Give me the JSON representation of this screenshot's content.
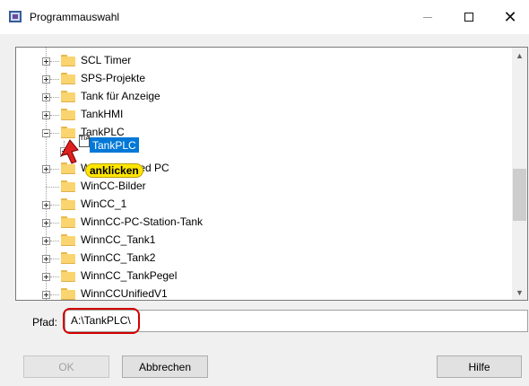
{
  "window": {
    "title": "Programmauswahl",
    "controls": {
      "minimize": "—",
      "maximize": "☐",
      "close": "✕"
    }
  },
  "tree": {
    "items": [
      {
        "label": "SCL Timer",
        "expandable": true,
        "expanded": false
      },
      {
        "label": "SPS-Projekte",
        "expandable": true,
        "expanded": false
      },
      {
        "label": "Tank für Anzeige",
        "expandable": true,
        "expanded": false
      },
      {
        "label": "TankHMI",
        "expandable": true,
        "expanded": false
      },
      {
        "label": "TankPLC",
        "expandable": true,
        "expanded": true
      },
      {
        "label": "TankPLC",
        "expandable": true,
        "expanded": false,
        "selected": true,
        "child": true
      },
      {
        "label": "WinCC Unified PC",
        "expandable": true,
        "expanded": false
      },
      {
        "label": "WinCC-Bilder",
        "expandable": false,
        "expanded": false
      },
      {
        "label": "WinCC_1",
        "expandable": true,
        "expanded": false
      },
      {
        "label": "WinnCC-PC-Station-Tank",
        "expandable": true,
        "expanded": false
      },
      {
        "label": "WinnCC_Tank1",
        "expandable": true,
        "expanded": false
      },
      {
        "label": "WinnCC_Tank2",
        "expandable": true,
        "expanded": false
      },
      {
        "label": "WinnCC_TankPegel",
        "expandable": true,
        "expanded": false
      },
      {
        "label": "WinnCCUnifiedV1",
        "expandable": true,
        "expanded": false
      }
    ]
  },
  "annotation": {
    "text": "anklicken",
    "color": "#ffe600"
  },
  "path": {
    "label": "Pfad:",
    "value": "A:\\TankPLC\\"
  },
  "buttons": {
    "ok": "OK",
    "cancel": "Abbrechen",
    "help": "Hilfe"
  },
  "colors": {
    "selection": "#0078d7",
    "highlight": "#d20000",
    "folder": "#fad46e"
  },
  "icons": {
    "tree_child": "tia-project-icon",
    "pointer": "red-arrow-cursor"
  }
}
